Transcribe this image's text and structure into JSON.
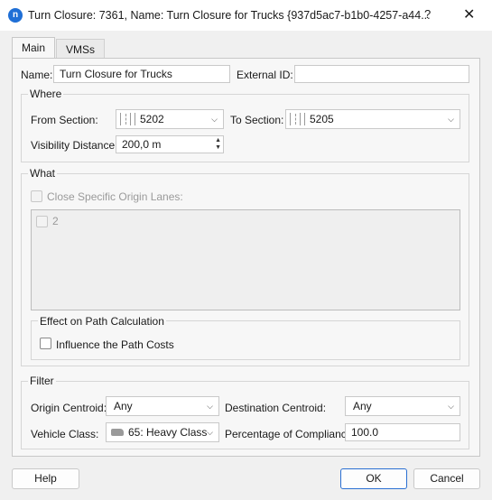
{
  "titlebar": {
    "app_icon": "n",
    "title": "Turn Closure: 7361, Name: Turn Closure for Trucks {937d5ac7-b1b0-4257-a44...",
    "help_label": "?",
    "close_label": "✕"
  },
  "tabs": [
    {
      "label": "Main",
      "selected": true
    },
    {
      "label": "VMSs",
      "selected": false
    }
  ],
  "main": {
    "name_label": "Name:",
    "name_value": "Turn Closure for Trucks",
    "external_id_label": "External ID:",
    "external_id_value": "",
    "where": {
      "title": "Where",
      "from_section_label": "From Section:",
      "from_section_value": "5202",
      "to_section_label": "To Section:",
      "to_section_value": "5205",
      "visibility_label": "Visibility Distance:",
      "visibility_value": "200,0 m"
    },
    "what": {
      "title": "What",
      "close_lanes_label": "Close Specific Origin Lanes:",
      "close_lanes_checked": false,
      "lanes": [
        {
          "label": "2",
          "checked": false
        }
      ],
      "effect": {
        "title": "Effect on Path Calculation",
        "influence_label": "Influence the Path Costs",
        "influence_checked": false
      }
    },
    "filter": {
      "title": "Filter",
      "origin_centroid_label": "Origin Centroid:",
      "origin_centroid_value": "Any",
      "destination_centroid_label": "Destination Centroid:",
      "destination_centroid_value": "Any",
      "vehicle_class_label": "Vehicle Class:",
      "vehicle_class_value": "65: Heavy Class",
      "compliance_label": "Percentage of Compliance:",
      "compliance_value": "100.0"
    }
  },
  "buttons": {
    "help": "Help",
    "ok": "OK",
    "cancel": "Cancel"
  },
  "colors": {
    "accent": "#1f6fd6",
    "ok_border": "#2a6fd2"
  }
}
